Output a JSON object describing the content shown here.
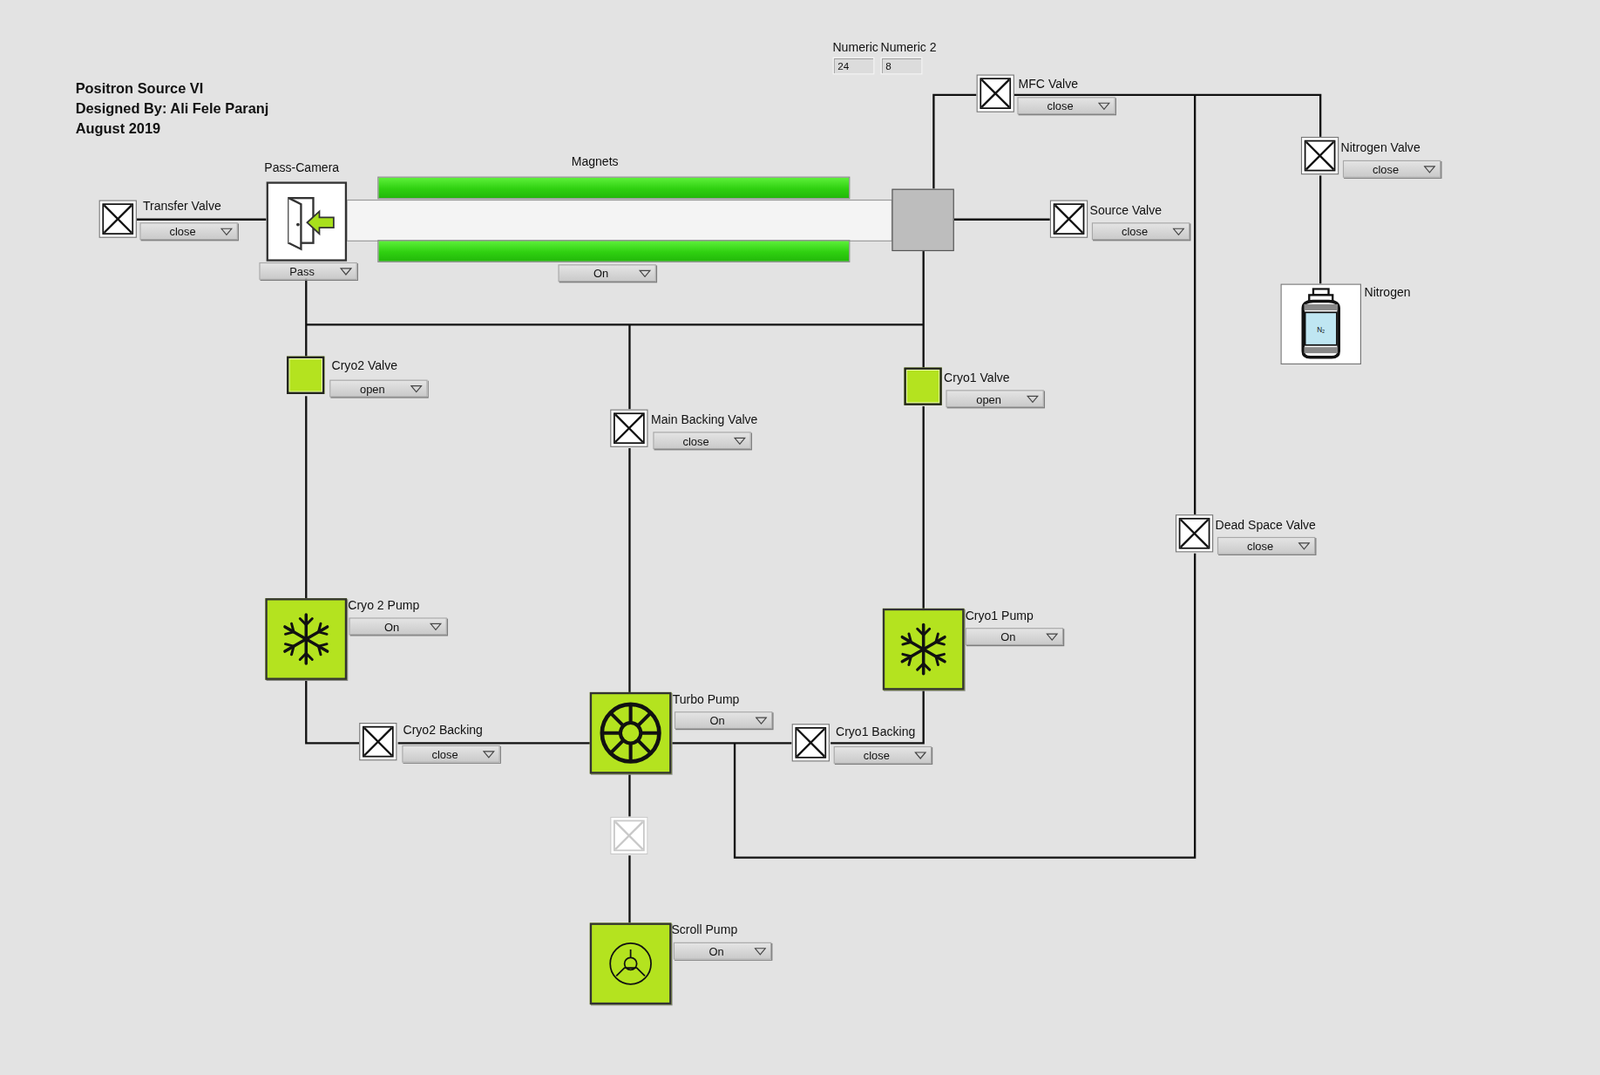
{
  "header": {
    "lines": [
      "Positron Source VI",
      "Designed By: Ali Fele Paranj",
      "August 2019"
    ]
  },
  "numerics": [
    {
      "label": "Numeric",
      "value": "24"
    },
    {
      "label": "Numeric 2",
      "value": "8"
    }
  ],
  "pass_camera": {
    "label": "Pass-Camera",
    "state": "Pass"
  },
  "magnets": {
    "label": "Magnets",
    "state": "On",
    "on": true
  },
  "valves": [
    {
      "label": "Transfer Valve",
      "state": "close",
      "open": false
    },
    {
      "label": "MFC Valve",
      "state": "close",
      "open": false
    },
    {
      "label": "Nitrogen Valve",
      "state": "close",
      "open": false
    },
    {
      "label": "Source Valve",
      "state": "close",
      "open": false
    },
    {
      "label": "Cryo2 Valve",
      "state": "open",
      "open": true
    },
    {
      "label": "Main Backing Valve",
      "state": "close",
      "open": false
    },
    {
      "label": "Cryo1 Valve",
      "state": "open",
      "open": true
    },
    {
      "label": "Dead Space Valve",
      "state": "close",
      "open": false
    },
    {
      "label": "Cryo2 Backing",
      "state": "close",
      "open": false
    },
    {
      "label": "Cryo1 Backing",
      "state": "close",
      "open": false
    }
  ],
  "scroll_valve": {
    "open": false,
    "disabled": true
  },
  "pumps": [
    {
      "label": "Cryo 2 Pump",
      "state": "On",
      "on": true,
      "kind": "cryo"
    },
    {
      "label": "Cryo1 Pump",
      "state": "On",
      "on": true,
      "kind": "cryo"
    },
    {
      "label": "Turbo Pump",
      "state": "On",
      "on": true,
      "kind": "turbo"
    },
    {
      "label": "Scroll Pump",
      "state": "On",
      "on": true,
      "kind": "scroll"
    }
  ],
  "nitrogen": {
    "label": "Nitrogen",
    "tank_text": "N₂"
  }
}
